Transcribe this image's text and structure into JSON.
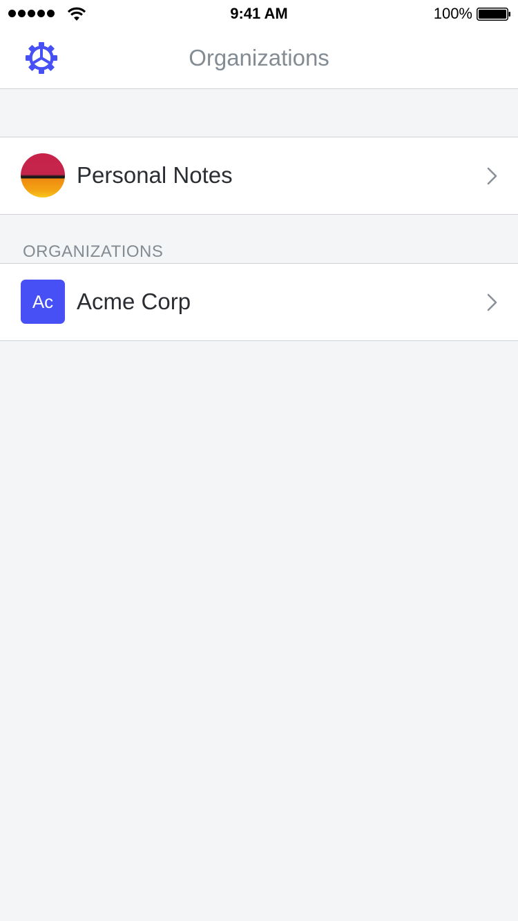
{
  "status_bar": {
    "time": "9:41 AM",
    "battery": "100%",
    "icons": [
      "signal-icon",
      "wifi-icon",
      "battery-icon"
    ]
  },
  "nav": {
    "title": "Organizations",
    "settings_icon": "gear-icon"
  },
  "personal": {
    "label": "Personal Notes"
  },
  "organizations": {
    "section_title": "ORGANIZATIONS",
    "items": [
      {
        "initials": "Ac",
        "label": "Acme Corp"
      }
    ]
  },
  "colors": {
    "accent": "#4650f5",
    "background": "#f4f5f7",
    "text_secondary": "#838b93",
    "text_primary": "#2a2e33"
  }
}
